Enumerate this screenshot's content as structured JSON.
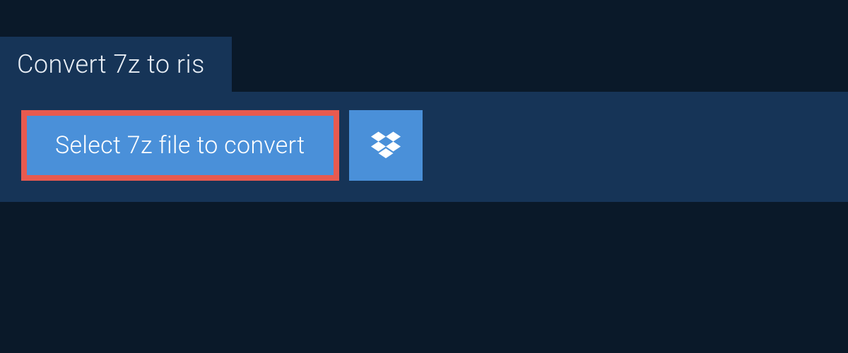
{
  "tab": {
    "title": "Convert 7z to ris"
  },
  "actions": {
    "select_file_label": "Select 7z file to convert",
    "dropbox_icon": "dropbox"
  }
}
